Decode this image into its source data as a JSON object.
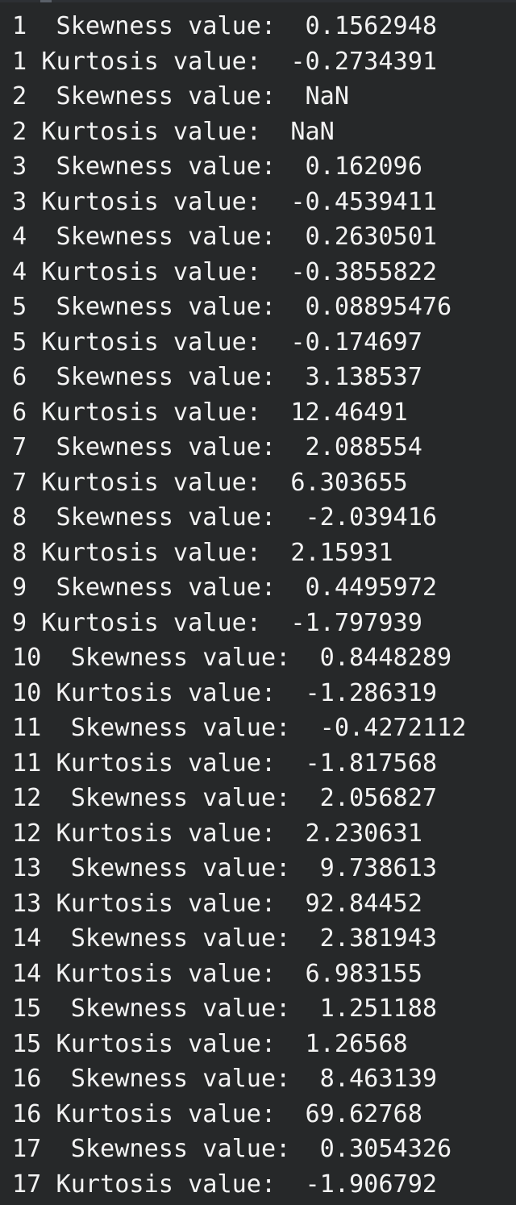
{
  "console": {
    "lines": [
      "1  Skewness value:  0.1562948",
      "1 Kurtosis value:  -0.2734391",
      "2  Skewness value:  NaN",
      "2 Kurtosis value:  NaN",
      "3  Skewness value:  0.162096",
      "3 Kurtosis value:  -0.4539411",
      "4  Skewness value:  0.2630501",
      "4 Kurtosis value:  -0.3855822",
      "5  Skewness value:  0.08895476",
      "5 Kurtosis value:  -0.174697",
      "6  Skewness value:  3.138537",
      "6 Kurtosis value:  12.46491",
      "7  Skewness value:  2.088554",
      "7 Kurtosis value:  6.303655",
      "8  Skewness value:  -2.039416",
      "8 Kurtosis value:  2.15931",
      "9  Skewness value:  0.4495972",
      "9 Kurtosis value:  -1.797939",
      "10  Skewness value:  0.8448289",
      "10 Kurtosis value:  -1.286319",
      "11  Skewness value:  -0.4272112",
      "11 Kurtosis value:  -1.817568",
      "12  Skewness value:  2.056827",
      "12 Kurtosis value:  2.230631",
      "13  Skewness value:  9.738613",
      "13 Kurtosis value:  92.84452",
      "14  Skewness value:  2.381943",
      "14 Kurtosis value:  6.983155",
      "15  Skewness value:  1.251188",
      "15 Kurtosis value:  1.26568",
      "16  Skewness value:  8.463139",
      "16 Kurtosis value:  69.62768",
      "17  Skewness value:  0.3054326",
      "17 Kurtosis value:  -1.906792"
    ]
  },
  "colors": {
    "background": "#262829",
    "text": "#f3f3f3"
  }
}
